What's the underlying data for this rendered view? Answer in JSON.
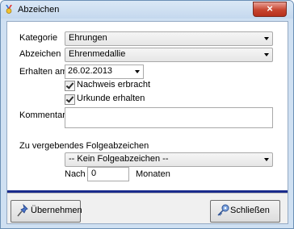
{
  "window": {
    "title": "Abzeichen",
    "close_glyph": "×"
  },
  "form": {
    "kategorie_label": "Kategorie",
    "kategorie_value": "Ehrungen",
    "abzeichen_label": "Abzeichen",
    "abzeichen_value": "Ehrenmedallie",
    "erhalten_label": "Erhalten am",
    "erhalten_value": "26.02.2013",
    "nachweis_label": "Nachweis erbracht",
    "urkunde_label": "Urkunde erhalten",
    "kommentar_label": "Kommentar",
    "kommentar_value": "",
    "folge_label": "Zu vergebendes Folgeabzeichen",
    "folge_value": "-- Kein Folgeabzeichen --",
    "nach_label": "Nach",
    "nach_value": "0",
    "monaten_label": "Monaten"
  },
  "checks": {
    "nachweis_checked": true,
    "urkunde_checked": true
  },
  "buttons": {
    "uebernehmen_label": "Übernehmen",
    "schliessen_label": "Schließen"
  },
  "colors": {
    "accent_bar": "#1a2b8c",
    "close_button": "#c7452f"
  },
  "icons": {
    "app": "medal-icon",
    "uebernehmen": "pushpin-icon",
    "schliessen": "key-icon"
  }
}
